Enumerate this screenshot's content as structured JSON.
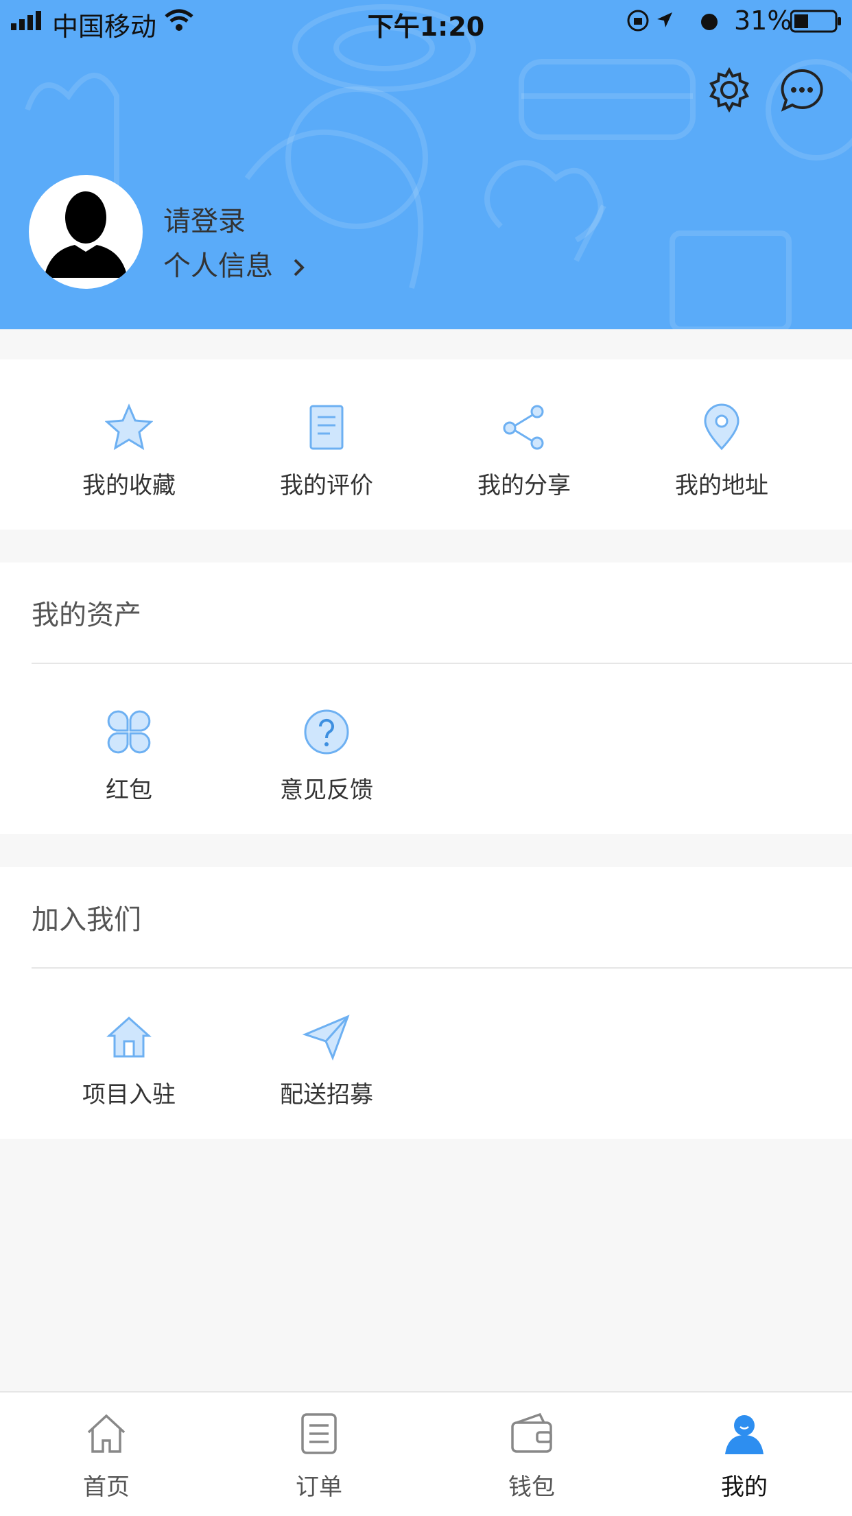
{
  "status_bar": {
    "carrier": "中国移动",
    "time": "下午1:20",
    "battery": "31%"
  },
  "header": {
    "login_text": "请登录",
    "profile_link": "个人信息",
    "background_color": "#5aabf9"
  },
  "quick_actions": [
    {
      "label": "我的收藏",
      "icon": "star-icon"
    },
    {
      "label": "我的评价",
      "icon": "document-icon"
    },
    {
      "label": "我的分享",
      "icon": "share-icon"
    },
    {
      "label": "我的地址",
      "icon": "location-pin-icon"
    }
  ],
  "assets": {
    "title": "我的资产",
    "items": [
      {
        "label": "红包",
        "icon": "clover-icon"
      },
      {
        "label": "意见反馈",
        "icon": "question-icon"
      }
    ]
  },
  "join": {
    "title": "加入我们",
    "items": [
      {
        "label": "项目入驻",
        "icon": "house-icon"
      },
      {
        "label": "配送招募",
        "icon": "paper-plane-icon"
      }
    ]
  },
  "tabbar": {
    "active_color": "#2d8ef0",
    "tabs": [
      {
        "label": "首页",
        "icon": "home-icon"
      },
      {
        "label": "订单",
        "icon": "order-icon"
      },
      {
        "label": "钱包",
        "icon": "wallet-icon"
      },
      {
        "label": "我的",
        "icon": "user-icon",
        "active": true
      }
    ]
  }
}
